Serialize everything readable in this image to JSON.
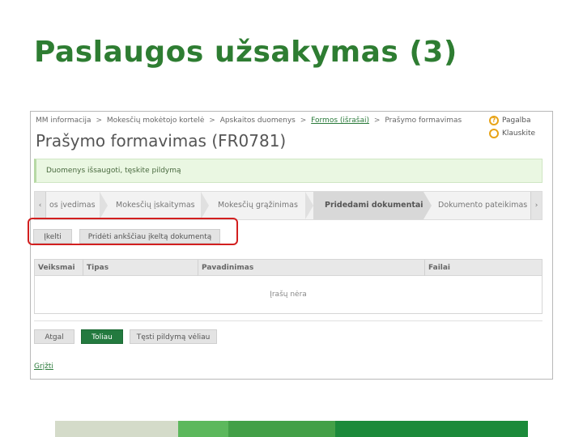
{
  "slide": {
    "title": "Paslaugos užsakymas (3)"
  },
  "breadcrumb": {
    "items": [
      "MM informacija",
      "Mokesčių mokėtojo kortelė",
      "Apskaitos duomenys",
      "Formos (išrašai)",
      "Prašymo formavimas"
    ],
    "separator": ">"
  },
  "help": {
    "help_label": "Pagalba",
    "ask_label": "Klauskite",
    "help_icon": "question-icon",
    "ask_icon": "ring-icon"
  },
  "page": {
    "heading": "Prašymo formavimas (FR0781)"
  },
  "notice": {
    "text": "Duomenys išsaugoti, tęskite pildymą"
  },
  "wizard": {
    "prev_icon": "‹",
    "next_icon": "›",
    "steps": [
      "os įvedimas",
      "Mokesčių įskaitymas",
      "Mokesčių grąžinimas",
      "Pridedami dokumentai",
      "Dokumento pateikimas"
    ],
    "active_index": 3
  },
  "doc_actions": {
    "upload_label": "Įkelti",
    "add_scanned_label": "Pridėti ankščiau įkeltą dokumentą"
  },
  "table": {
    "columns": [
      "Veiksmai",
      "Tipas",
      "Pavadinimas",
      "Failai"
    ],
    "empty_text": "Įrašų nėra"
  },
  "nav": {
    "back_label": "Atgal",
    "next_label": "Toliau",
    "continue_later_label": "Tęsti pildymą vėliau"
  },
  "footer": {
    "return_label": "Grįžti"
  },
  "colors": {
    "title_green": "#2e7d32",
    "primary_button": "#237a3f",
    "highlight_red": "#d21f1f",
    "notice_bg": "#eaf7e2",
    "footer_segments": [
      "#d4dbc9",
      "#5cb85c",
      "#43a047",
      "#1b8a3a"
    ]
  }
}
